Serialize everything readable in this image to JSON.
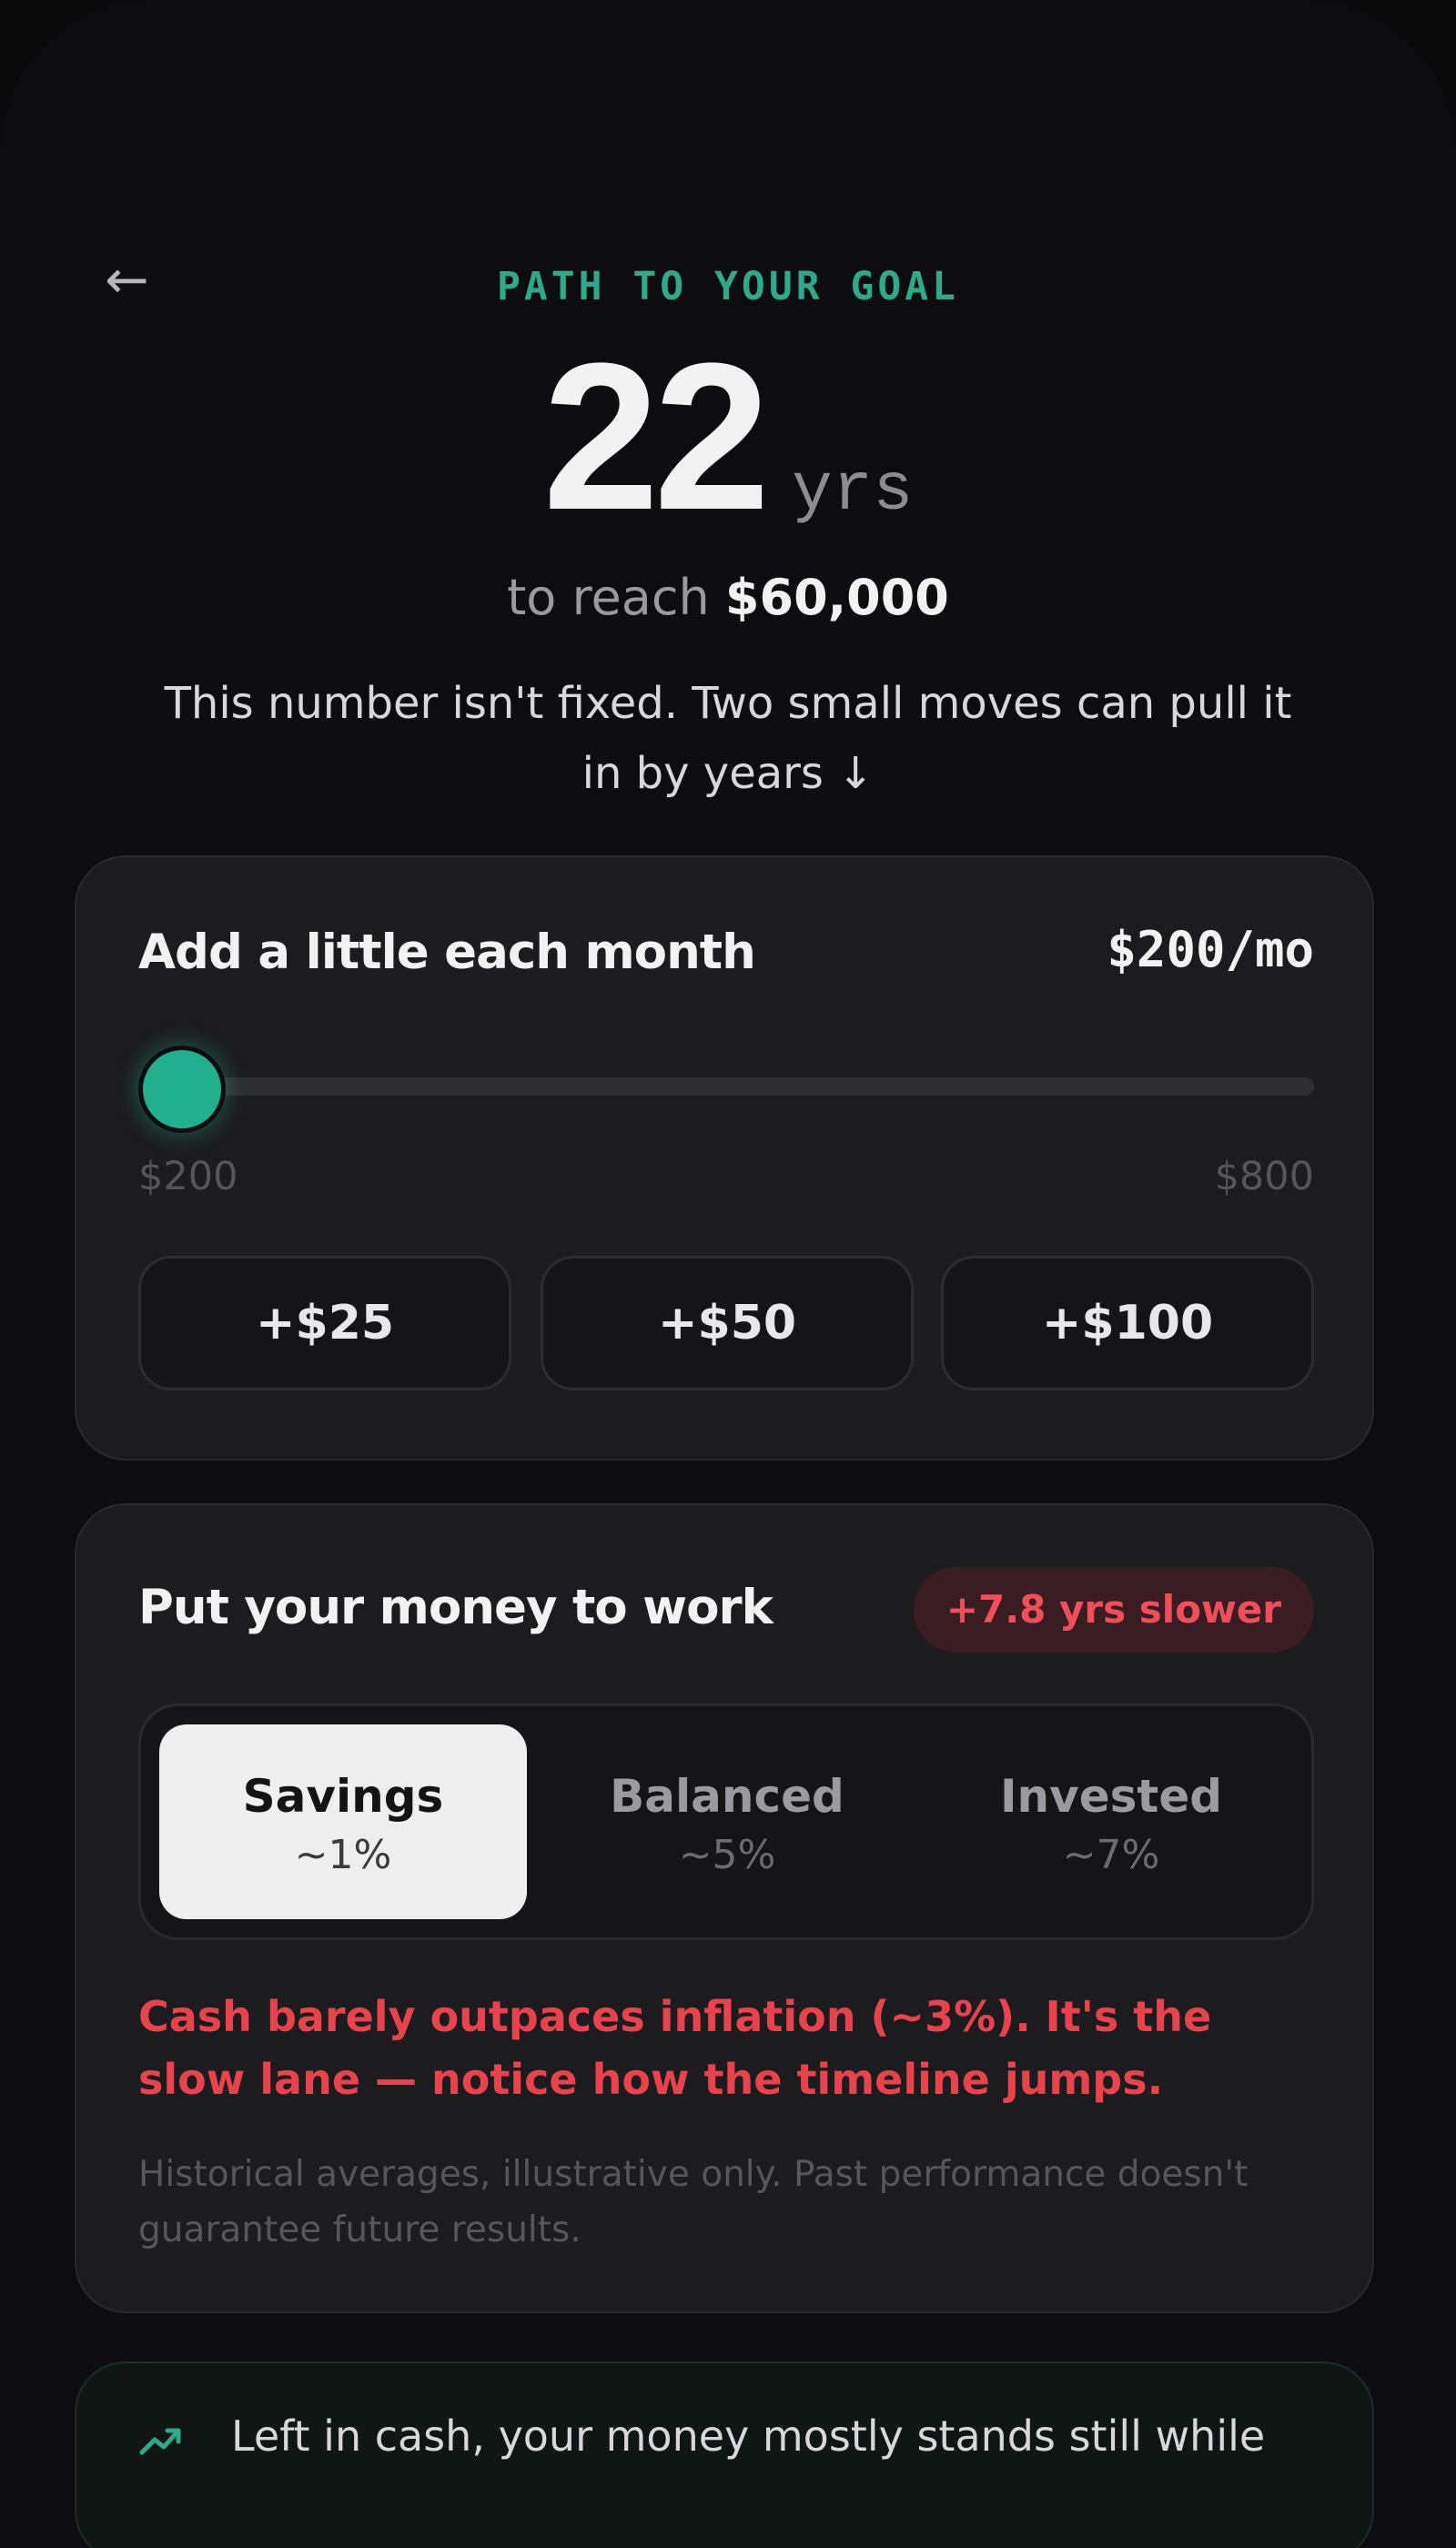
{
  "header": {
    "back_glyph": "←",
    "eyebrow": "PATH TO YOUR GOAL",
    "years": "22",
    "years_unit": "yrs",
    "reach_prefix": "to reach",
    "goal_amount": "$60,000",
    "intro": "This number isn't fixed. Two small moves can pull it in by years ↓"
  },
  "monthly": {
    "title": "Add a little each month",
    "amount": "$200/mo",
    "slider_min": "$200",
    "slider_max": "$800",
    "slider_fraction": 0,
    "accent_color": "#21b08d",
    "quick_adds": [
      "+$25",
      "+$50",
      "+$100"
    ]
  },
  "invest": {
    "title": "Put your money to work",
    "badge": "+7.8 yrs slower",
    "badge_color": "#ef4f5a",
    "options": [
      {
        "name": "Savings",
        "rate": "~1%",
        "selected": true
      },
      {
        "name": "Balanced",
        "rate": "~5%",
        "selected": false
      },
      {
        "name": "Invested",
        "rate": "~7%",
        "selected": false
      }
    ],
    "warning": "Cash barely outpaces inflation (~3%). It's the slow lane — notice how the timeline jumps.",
    "disclaimer": "Historical averages, illustrative only. Past performance doesn't guarantee future results."
  },
  "tip": {
    "icon": "trend-up-icon",
    "text": "Left in cash, your money mostly stands still while"
  }
}
